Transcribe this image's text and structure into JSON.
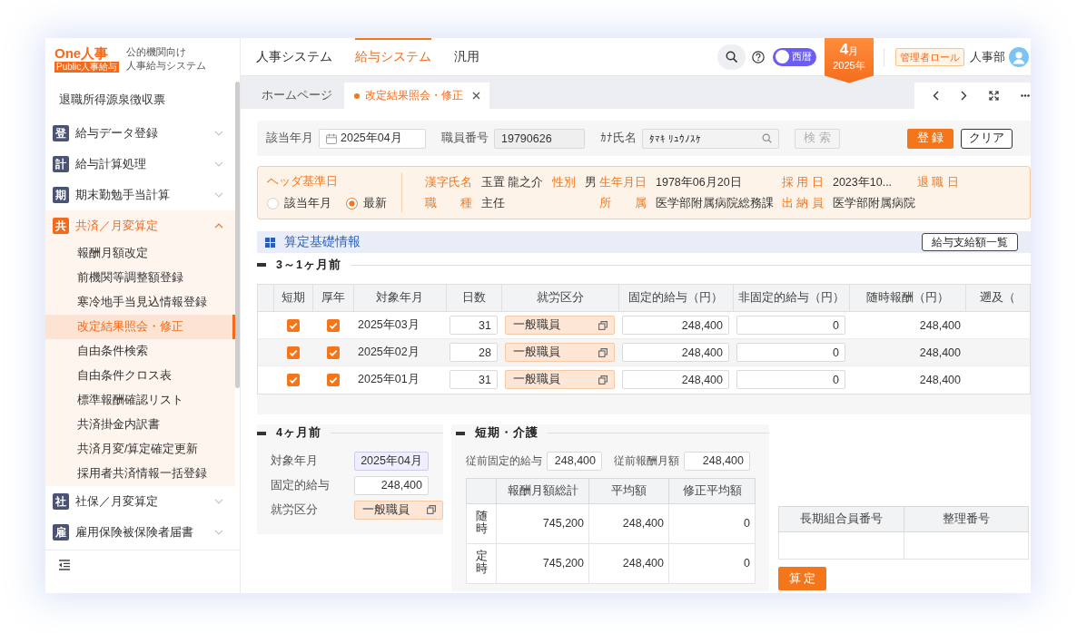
{
  "logo": {
    "wordmark": "One人事",
    "badge": "Public人事給与",
    "caption_lines": [
      "公的機関向け",
      "人事給与システム"
    ]
  },
  "sidebar": {
    "items": [
      {
        "kind": "link",
        "label": "退職所得源泉徴収票",
        "selected": false
      },
      {
        "kind": "group",
        "glyph": "登",
        "label": "給与データ登録",
        "expanded": false
      },
      {
        "kind": "group",
        "glyph": "計",
        "label": "給与計算処理",
        "expanded": false
      },
      {
        "kind": "group",
        "glyph": "期",
        "label": "期末勤勉手当計算",
        "expanded": false
      },
      {
        "kind": "group",
        "glyph": "共",
        "label": "共済／月変算定",
        "expanded": true,
        "children": [
          {
            "label": "報酬月額改定",
            "selected": false
          },
          {
            "label": "前機関等調整額登録",
            "selected": false
          },
          {
            "label": "寒冷地手当見込情報登録",
            "selected": false
          },
          {
            "label": "改定結果照会・修正",
            "selected": true
          },
          {
            "label": "自由条件検索",
            "selected": false
          },
          {
            "label": "自由条件クロス表",
            "selected": false
          },
          {
            "label": "標準報酬確認リスト",
            "selected": false
          },
          {
            "label": "共済掛金内訳書",
            "selected": false
          },
          {
            "label": "共済月変/算定確定更新",
            "selected": false
          },
          {
            "label": "採用者共済情報一括登録",
            "selected": false
          }
        ]
      },
      {
        "kind": "group",
        "glyph": "社",
        "label": "社保／月変算定",
        "expanded": false
      },
      {
        "kind": "group",
        "glyph": "雇",
        "label": "雇用保険被保険者届書",
        "expanded": false
      }
    ]
  },
  "nav_tabs": [
    {
      "label": "人事システム",
      "selected": false
    },
    {
      "label": "給与システム",
      "selected": true
    },
    {
      "label": "汎用",
      "selected": false
    }
  ],
  "toolbar": {
    "era_toggle": {
      "label": "西暦",
      "on": false
    },
    "period": {
      "month": "4",
      "month_unit": "月",
      "year": "2025年"
    },
    "role": "管理者ロール",
    "user": "人事部"
  },
  "page_tabs": [
    {
      "label": "ホームページ",
      "selected": false
    },
    {
      "label": "改定結果照会・修正",
      "selected": true
    }
  ],
  "search_form": {
    "fields": [
      {
        "kind": "date",
        "label": "該当年月",
        "value": "2025年04月"
      },
      {
        "kind": "readonly",
        "label": "職員番号",
        "value": "19790626"
      },
      {
        "kind": "search",
        "label": "ｶﾅ氏名",
        "value": "ﾀﾏｷ ﾘｭｳﾉｽｹ"
      }
    ],
    "search_button": {
      "label": "検 索",
      "disabled": true
    },
    "actions": [
      {
        "kind": "primary",
        "label": "登 録"
      },
      {
        "kind": "outline",
        "label": "クリア"
      }
    ]
  },
  "header_info": {
    "title": "ヘッダ基準日",
    "radios": [
      {
        "label": "該当年月",
        "selected": false
      },
      {
        "label": "最新",
        "selected": true
      }
    ],
    "columns": [
      {
        "fields": [
          {
            "label": "漢字氏名",
            "value": "玉置 龍之介"
          },
          {
            "label": "職　　種",
            "value": "主任"
          }
        ]
      },
      {
        "fields": [
          {
            "label": "性別",
            "value": "男"
          }
        ]
      },
      {
        "fields": [
          {
            "label": "生年月日",
            "value": "1978年06月20日"
          },
          {
            "label": "所　　属",
            "value": "医学部附属病院総務課"
          }
        ]
      },
      {
        "fields": [
          {
            "label": "採 用 日",
            "value": "2023年10..."
          },
          {
            "label": "出 納 員",
            "value": "医学部附属病院"
          }
        ]
      },
      {
        "fields": [
          {
            "label": "退 職 日"
          }
        ]
      }
    ]
  },
  "calc_section": {
    "title": "算定基礎情報",
    "button": "給与支給額一覧",
    "recent": {
      "title": "3～1ヶ月前",
      "columns": [
        "短期",
        "厚年",
        "対象年月",
        "日数",
        "就労区分",
        "固定的給与（円）",
        "非固定的給与（円）",
        "随時報酬（円）",
        "遡及（"
      ],
      "rows": [
        {
          "short_term": {
            "checked": true
          },
          "pension": {
            "checked": true
          },
          "month": "2025年03月",
          "days": "31",
          "work_type": "一般職員",
          "fixed_pay": "248,400",
          "variable_pay": "0",
          "adhoc_pay": "248,400"
        },
        {
          "short_term": {
            "checked": true
          },
          "pension": {
            "checked": true
          },
          "month": "2025年02月",
          "days": "28",
          "work_type": "一般職員",
          "fixed_pay": "248,400",
          "variable_pay": "0",
          "adhoc_pay": "248,400"
        },
        {
          "short_term": {
            "checked": true
          },
          "pension": {
            "checked": true
          },
          "month": "2025年01月",
          "days": "31",
          "work_type": "一般職員",
          "fixed_pay": "248,400",
          "variable_pay": "0",
          "adhoc_pay": "248,400"
        }
      ]
    },
    "four_months_ago": {
      "title": "4ヶ月前",
      "fields": [
        {
          "kind": "month",
          "label": "対象年月",
          "value": "2025年04月"
        },
        {
          "kind": "number",
          "label": "固定的給与",
          "value": "248,400"
        },
        {
          "kind": "select",
          "label": "就労区分",
          "value": "一般職員"
        }
      ]
    },
    "short_term_care": {
      "title": "短期・介護",
      "fields": [
        {
          "label": "従前固定的給与",
          "value": "248,400"
        },
        {
          "label": "従前報酬月額",
          "value": "248,400"
        }
      ],
      "table": {
        "columns": [
          "報酬月額総計",
          "平均額",
          "修正平均額"
        ],
        "rows": [
          {
            "label": "随時",
            "values": [
              "745,200",
              "248,400",
              "0"
            ]
          },
          {
            "label": "定時",
            "values": [
              "745,200",
              "248,400",
              "0"
            ]
          }
        ]
      }
    },
    "member_table": {
      "columns": [
        "長期組合員番号",
        "整理番号"
      ]
    },
    "submit_button": "算 定"
  }
}
